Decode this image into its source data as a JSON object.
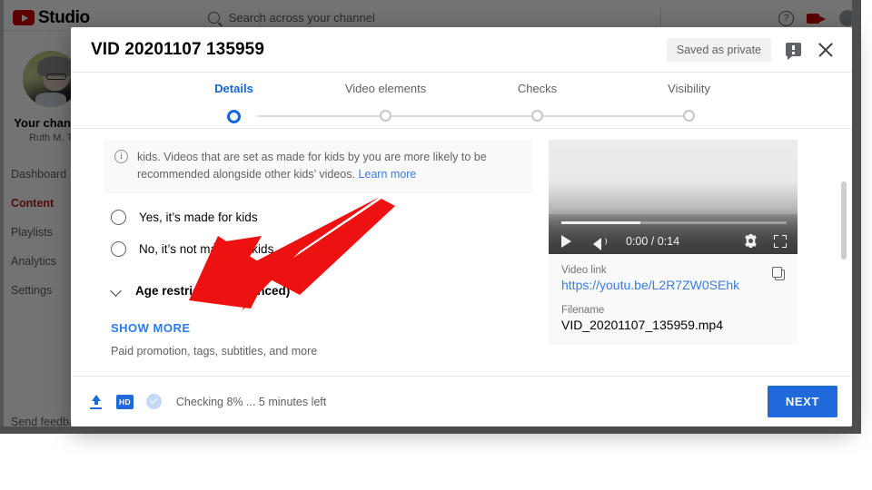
{
  "app": {
    "brand": "Studio",
    "brand_icon": "youtube-play-icon",
    "search_placeholder": "Search across your channel",
    "search_icon": "search-icon",
    "help_icon": "help-circle-icon",
    "create_icon": "create-video-icon",
    "avatar_icon": "account-avatar"
  },
  "sidebar": {
    "channel_heading": "Your channel",
    "channel_name": "Ruth M. T",
    "items": [
      {
        "label": "Dashboard",
        "active": false
      },
      {
        "label": "Content",
        "active": true
      },
      {
        "label": "Playlists",
        "active": false
      },
      {
        "label": "Analytics",
        "active": false
      },
      {
        "label": "Settings",
        "active": false
      }
    ],
    "footer_item": "Send feedback"
  },
  "dialog": {
    "title": "VID 20201107 135959",
    "saved_chip": "Saved as private",
    "feedback_icon": "feedback-icon",
    "close_icon": "close-icon",
    "steps": [
      {
        "label": "Details",
        "current": true
      },
      {
        "label": "Video elements",
        "current": false
      },
      {
        "label": "Checks",
        "current": false
      },
      {
        "label": "Visibility",
        "current": false
      }
    ],
    "info_banner": {
      "icon": "info-icon",
      "text": "kids. Videos that are set as made for kids by you are more likely to be recommended alongside other kids’ videos.",
      "link": "Learn more"
    },
    "radios": [
      {
        "label": "Yes, it’s made for kids",
        "selected": false
      },
      {
        "label": "No, it’s not made for kids",
        "selected": false
      }
    ],
    "collapse_section": {
      "label": "Age restriction (advanced)",
      "icon": "chevron-down-icon"
    },
    "show_more": "SHOW MORE",
    "show_more_sub": "Paid promotion, tags, subtitles, and more",
    "preview": {
      "play_icon": "play-icon",
      "volume_icon": "volume-icon",
      "time": "0:00 / 0:14",
      "settings_icon": "gear-icon",
      "fullscreen_icon": "fullscreen-icon",
      "progress_percent": 35
    },
    "meta": {
      "link_label": "Video link",
      "link_value": "https://youtu.be/L2R7ZW0SEhk",
      "filename_label": "Filename",
      "filename_value": "VID_20201107_135959.mp4",
      "copy_icon": "copy-icon"
    },
    "footer": {
      "upload_icon": "upload-icon",
      "hd_badge": "HD",
      "check_icon": "check-circle-icon",
      "status": "Checking 8% ... 5 minutes left",
      "next_label": "NEXT"
    }
  },
  "annotation": {
    "arrow_color": "#ee1111",
    "arrow_name": "red-pointer-arrow"
  },
  "colors": {
    "accent_blue": "#1f69da",
    "link_blue": "#3b7ce0",
    "brand_red": "#cc0000",
    "active_nav": "#ab1d1d"
  }
}
